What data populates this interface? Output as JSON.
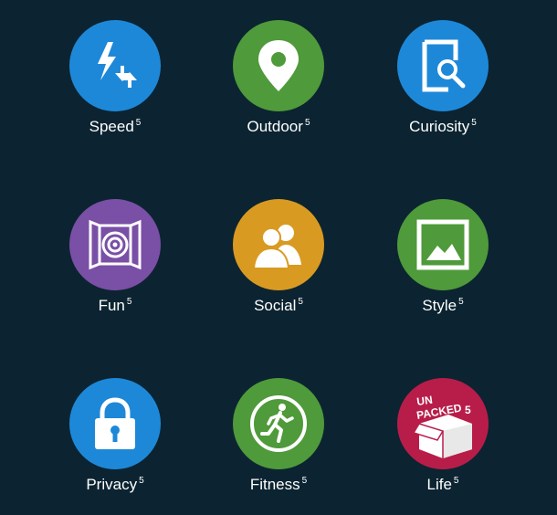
{
  "colors": {
    "background": "#0c2431",
    "blue": "#1e88d8",
    "green": "#4f9a3a",
    "purple": "#7a4fa6",
    "orange": "#d99a22",
    "crimson": "#b81d4a",
    "icon": "#ffffff"
  },
  "tiles": [
    {
      "name": "Speed",
      "sup": "5",
      "icon": "lightning-arrows-icon",
      "color": "#1e88d8"
    },
    {
      "name": "Outdoor",
      "sup": "5",
      "icon": "map-pin-icon",
      "color": "#4f9a3a"
    },
    {
      "name": "Curiosity",
      "sup": "5",
      "icon": "document-search-icon",
      "color": "#1e88d8"
    },
    {
      "name": "Fun",
      "sup": "5",
      "icon": "target-frame-icon",
      "color": "#7a4fa6"
    },
    {
      "name": "Social",
      "sup": "5",
      "icon": "people-icon",
      "color": "#d99a22"
    },
    {
      "name": "Style",
      "sup": "5",
      "icon": "landscape-picture-icon",
      "color": "#4f9a3a"
    },
    {
      "name": "Privacy",
      "sup": "5",
      "icon": "padlock-icon",
      "color": "#1e88d8"
    },
    {
      "name": "Fitness",
      "sup": "5",
      "icon": "runner-icon",
      "color": "#4f9a3a"
    },
    {
      "name": "Life",
      "sup": "5",
      "icon": "unpacked-box-icon",
      "color": "#b81d4a",
      "icon_text_1": "UN",
      "icon_text_2": "PACKED",
      "icon_text_3": "5"
    }
  ]
}
